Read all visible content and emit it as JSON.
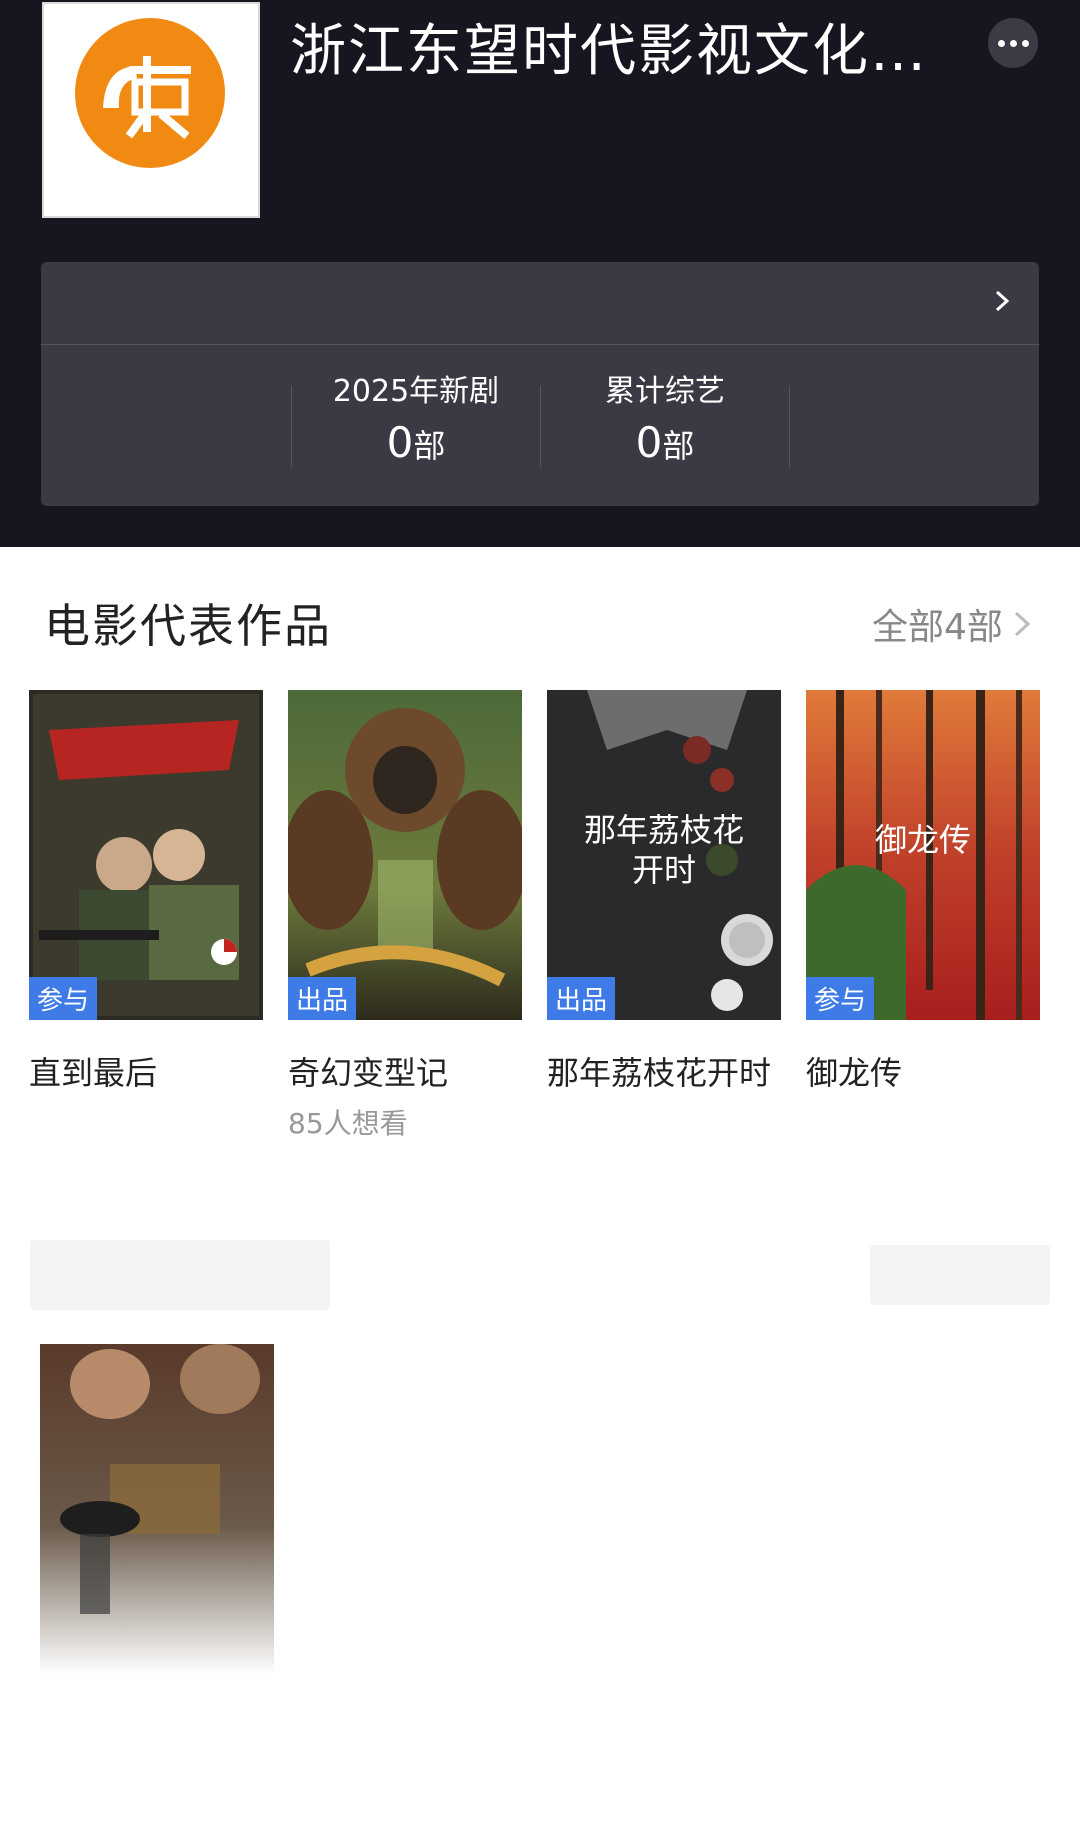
{
  "header": {
    "company_name": "浙江东望时代影视文化有...",
    "logo_icon": "orange-circle-logo-icon",
    "more_icon": "more-dots-icon"
  },
  "stats": {
    "items": [
      {
        "label": "2025年新剧",
        "value": "0",
        "unit": "部"
      },
      {
        "label": "累计综艺",
        "value": "0",
        "unit": "部"
      }
    ]
  },
  "section": {
    "title": "电影代表作品",
    "all_link": "全部4部"
  },
  "films": [
    {
      "title": "直到最后",
      "role": "参与",
      "subtitle": ""
    },
    {
      "title": "奇幻变型记",
      "role": "出品",
      "subtitle": "85人想看"
    },
    {
      "title": "那年荔枝花开时",
      "role": "出品",
      "subtitle": "",
      "poster_text": "那年荔枝花\n开时"
    },
    {
      "title": "御龙传",
      "role": "参与",
      "subtitle": "",
      "poster_text": "御龙传"
    }
  ],
  "colors": {
    "header_bg": "#17151f",
    "panel_bg": "#3a3a44",
    "tag_blue": "#3f7be6",
    "logo_orange": "#f08a12"
  }
}
